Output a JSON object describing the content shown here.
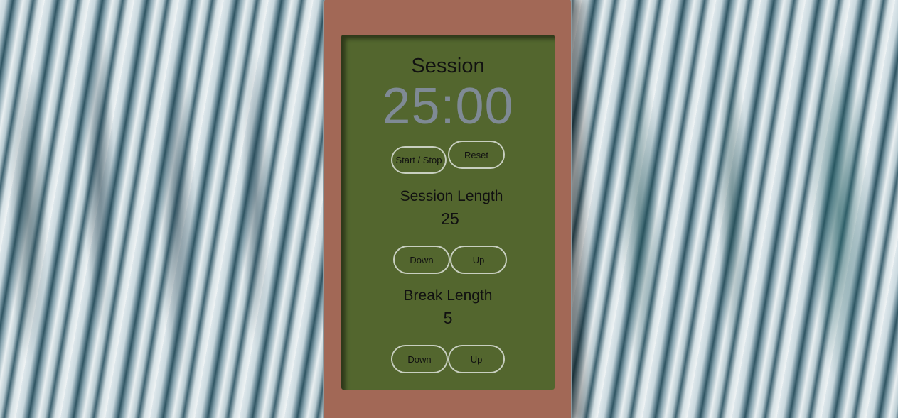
{
  "timer": {
    "label": "Session",
    "time": "25:00"
  },
  "controls": {
    "start_stop": "Start / Stop",
    "reset": "Reset"
  },
  "session": {
    "label": "Session Length",
    "value": "25",
    "down": "Down",
    "up": "Up"
  },
  "break": {
    "label": "Break Length",
    "value": "5",
    "down": "Down",
    "up": "Up"
  },
  "colors": {
    "card": "#a26856",
    "panel": "#53662e",
    "time_text": "#7f8a95",
    "button_border": "#c8cfc0"
  }
}
